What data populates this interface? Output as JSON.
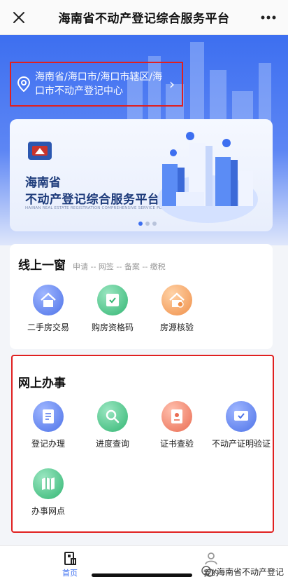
{
  "topbar": {
    "title": "海南省不动产登记综合服务平台",
    "close_icon": "close-icon",
    "more_icon": "more-icon"
  },
  "location": {
    "text": "海南省/海口市/海口市辖区/海口市不动产登记中心",
    "icon": "location-pin-icon"
  },
  "banner": {
    "title_line1": "海南省",
    "title_line2": "不动产登记综合服务平台",
    "subtitle": "HAINAN REAL ESTATE REGISTRATION COMPREHENSIVE SERVICE PLATFORM",
    "page_count": 3,
    "active_page": 1
  },
  "online_window": {
    "title": "线上一窗",
    "subtitle": "申请 -- 网签 -- 备案 -- 缴税",
    "items": [
      {
        "label": "二手房交易",
        "icon": "house-trade-icon",
        "color": "#5b7ff0"
      },
      {
        "label": "购房资格码",
        "icon": "qualification-code-icon",
        "color": "#3dbf7a"
      },
      {
        "label": "房源核验",
        "icon": "house-verify-icon",
        "color": "#f29a52"
      }
    ]
  },
  "online_services": {
    "title": "网上办事",
    "items": [
      {
        "label": "登记办理",
        "icon": "registration-icon",
        "color": "#5b7ff0"
      },
      {
        "label": "进度查询",
        "icon": "progress-search-icon",
        "color": "#3dbf7a"
      },
      {
        "label": "证书查验",
        "icon": "certificate-check-icon",
        "color": "#f07b63"
      },
      {
        "label": "不动产证明验证",
        "icon": "proof-verify-icon",
        "color": "#5b7ff0"
      },
      {
        "label": "办事网点",
        "icon": "service-location-icon",
        "color": "#3dbf7a"
      }
    ]
  },
  "tabbar": {
    "home_label": "首页",
    "mine_label": "我的",
    "active_color": "#3d6ff0"
  },
  "watermark": {
    "text": "海南省不动产登记"
  }
}
